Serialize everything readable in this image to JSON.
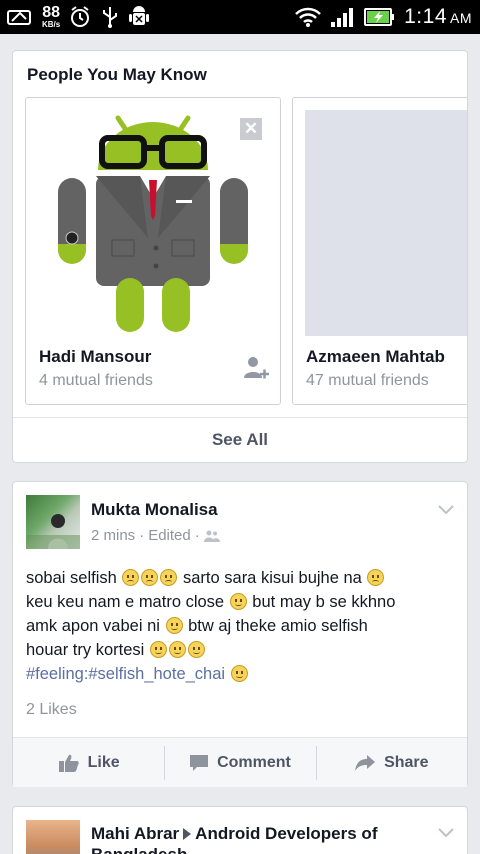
{
  "status_bar": {
    "speed_value": "88",
    "speed_unit": "KB/s",
    "time": "1:14",
    "ampm": "AM",
    "icons": [
      "screenshot-icon",
      "alarm-icon",
      "usb-icon",
      "android-debug-icon",
      "wifi-icon",
      "signal-icon",
      "battery-charging-icon"
    ]
  },
  "pymk": {
    "title": "People You May Know",
    "people": [
      {
        "name": "Hadi Mansour",
        "mutual": "4 mutual friends"
      },
      {
        "name": "Azmaeen Mahtab",
        "mutual": "47 mutual friends"
      }
    ],
    "see_all": "See All"
  },
  "post": {
    "author": "Mukta Monalisa",
    "time": "2 mins",
    "edited": "Edited",
    "text": {
      "l1a": "sobai selfish",
      "l1b": "sarto sara kisui bujhe na",
      "l2a": "keu keu nam e matro close",
      "l2b": "but may b se kkhno",
      "l3a": "amk apon vabei ni",
      "l3b": "btw aj theke amio selfish",
      "l4": "houar try kortesi",
      "l5": "#feeling:#selfish_hote_chai"
    },
    "likes": "2 Likes",
    "actions": {
      "like": "Like",
      "comment": "Comment",
      "share": "Share"
    }
  },
  "post2": {
    "author": "Mahi Abrar",
    "group": "Android Developers of",
    "group_cont": "Bangladesh"
  }
}
